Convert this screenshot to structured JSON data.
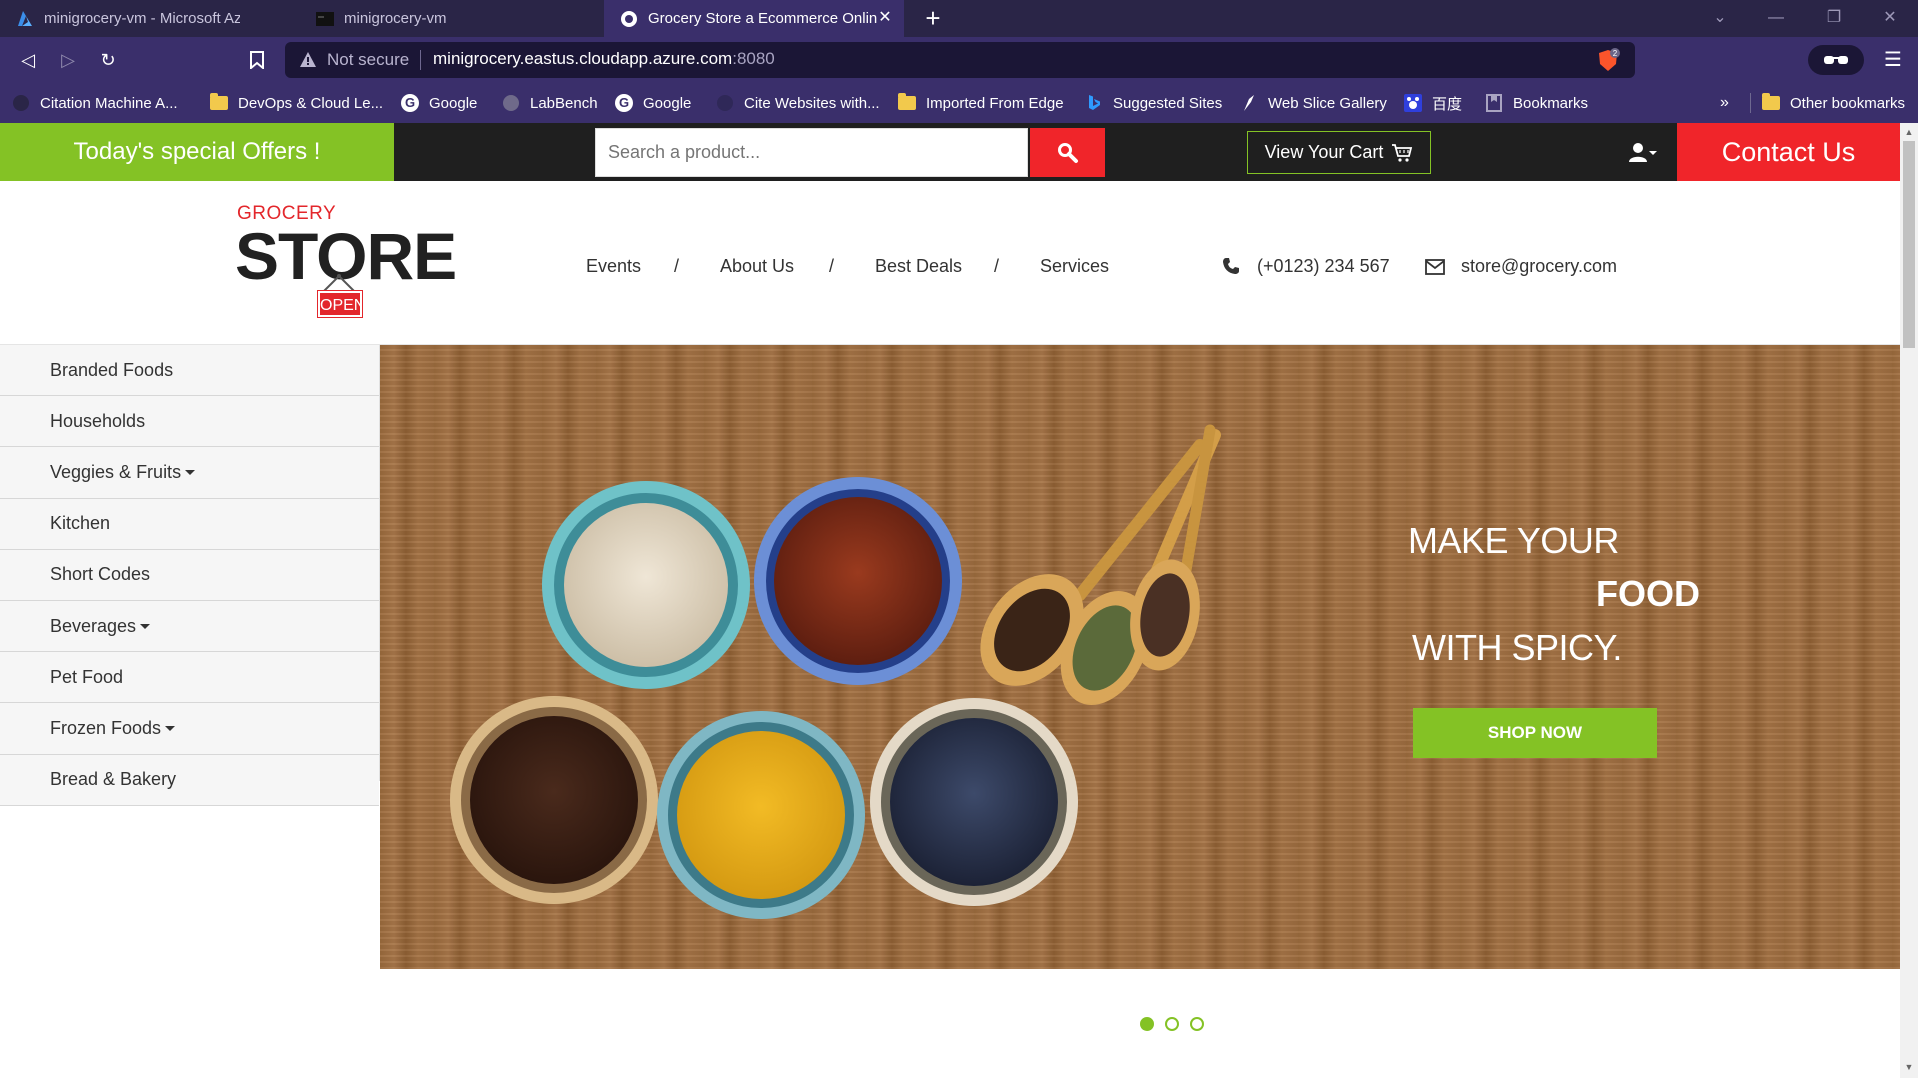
{
  "browser": {
    "tabs": [
      {
        "title": "minigrocery-vm - Microsoft Azure",
        "icon": "azure-icon",
        "active": false
      },
      {
        "title": "minigrocery-vm",
        "icon": "terminal-icon",
        "active": false
      },
      {
        "title": "Grocery Store a Ecommerce Onlin",
        "icon": "globe-icon",
        "active": true
      }
    ],
    "new_tab": "+",
    "address": {
      "warning": "Not secure",
      "url_host": "minigrocery.eastus.cloudapp.azure.com",
      "url_port": ":8080"
    },
    "bookmarks": [
      {
        "label": "Citation Machine  A...",
        "icon": "citation-icon"
      },
      {
        "label": "DevOps & Cloud Le...",
        "icon": "folder-icon"
      },
      {
        "label": "Google",
        "icon": "google-icon"
      },
      {
        "label": "LabBench",
        "icon": "globe-icon"
      },
      {
        "label": "Google",
        "icon": "google-icon"
      },
      {
        "label": "Cite Websites with...",
        "icon": "cite-icon"
      },
      {
        "label": "Imported From Edge",
        "icon": "folder-icon"
      },
      {
        "label": "Suggested Sites",
        "icon": "bing-icon"
      },
      {
        "label": "Web Slice Gallery",
        "icon": "web-slice-icon"
      },
      {
        "label": "百度",
        "icon": "baidu-icon"
      },
      {
        "label": "Bookmarks",
        "icon": "bookmark-page-icon"
      }
    ],
    "bookmarks_more": "»",
    "other_bookmarks": "Other bookmarks"
  },
  "site": {
    "offers_label": "Today's special Offers !",
    "search_placeholder": "Search a product...",
    "cart_label": "View Your Cart",
    "contact_label": "Contact Us",
    "logo": {
      "top": "GROCERY",
      "main": "STORE",
      "sign": "OPEN"
    },
    "nav": [
      "Events",
      "About Us",
      "Best Deals",
      "Services"
    ],
    "nav_separator": "/",
    "phone": "(+0123) 234 567",
    "email": "store@grocery.com",
    "categories": [
      {
        "label": "Branded Foods",
        "dropdown": false
      },
      {
        "label": "Households",
        "dropdown": false
      },
      {
        "label": "Veggies & Fruits",
        "dropdown": true
      },
      {
        "label": "Kitchen",
        "dropdown": false
      },
      {
        "label": "Short Codes",
        "dropdown": false
      },
      {
        "label": "Beverages",
        "dropdown": true
      },
      {
        "label": "Pet Food",
        "dropdown": false
      },
      {
        "label": "Frozen Foods",
        "dropdown": true
      },
      {
        "label": "Bread & Bakery",
        "dropdown": false
      }
    ],
    "banner": {
      "line1": "MAKE YOUR",
      "line2": "FOOD",
      "line3": "WITH SPICY.",
      "cta": "SHOP NOW"
    },
    "slider": {
      "total": 3,
      "active": 1
    }
  },
  "colors": {
    "brand_green": "#84c225",
    "brand_red": "#f0252a",
    "topbar_dark": "#1f1f1f",
    "browser_purple": "#3a2f6b"
  }
}
